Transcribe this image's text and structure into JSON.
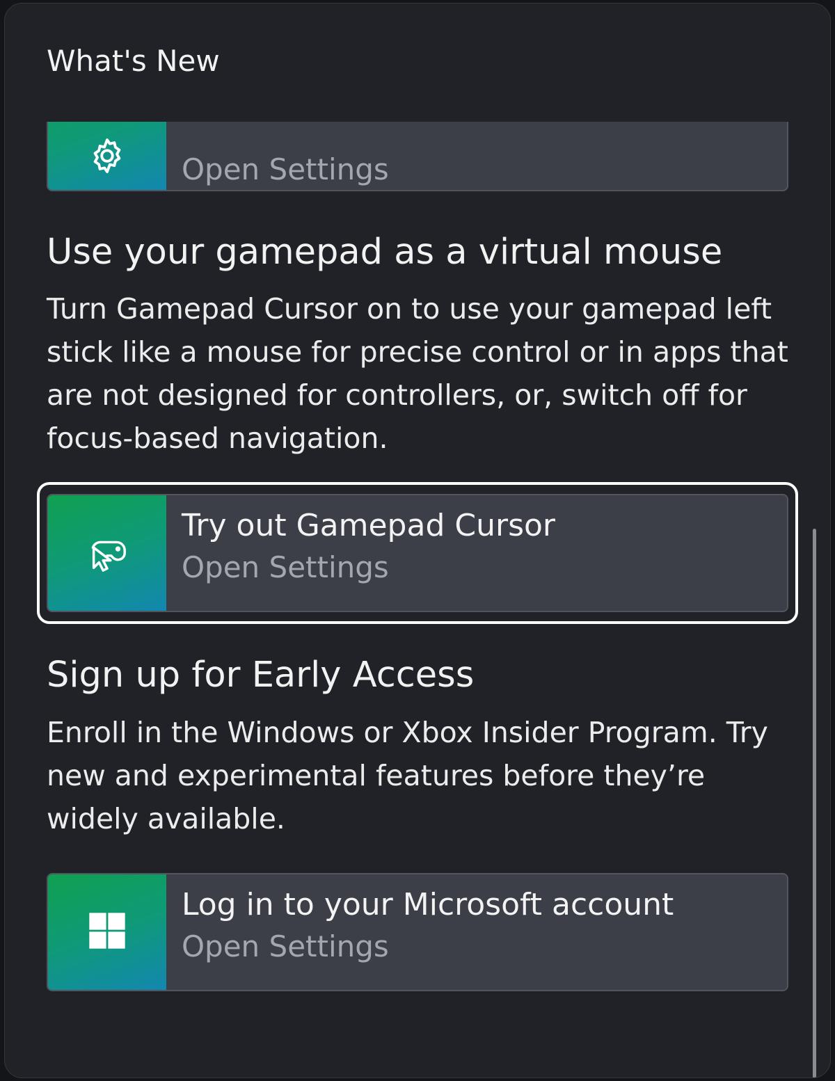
{
  "panel": {
    "title": "What's New"
  },
  "cards": [
    {
      "title": "",
      "subtitle": "Open Settings",
      "icon": "gear-icon"
    },
    {
      "title": "Try out Gamepad Cursor",
      "subtitle": "Open Settings",
      "icon": "gamepad-cursor-icon"
    },
    {
      "title": "Log in to your Microsoft account",
      "subtitle": "Open Settings",
      "icon": "windows-logo-icon"
    }
  ],
  "sections": [
    {
      "heading": "Use your gamepad as a virtual mouse",
      "body": "Turn Gamepad Cursor on to use your gamepad left stick like a mouse for precise control or in apps that are not designed for controllers, or, switch off for focus-based navigation."
    },
    {
      "heading": "Sign up for Early Access",
      "body": "Enroll in the Windows or Xbox Insider Program. Try new and experimental features before they’re widely available."
    }
  ],
  "colors": {
    "panel_bg": "#202227",
    "card_bg": "#3c3f48",
    "tile_gradient_start": "#10a050",
    "tile_gradient_end": "#1287b0",
    "focus_ring": "#ffffff"
  }
}
